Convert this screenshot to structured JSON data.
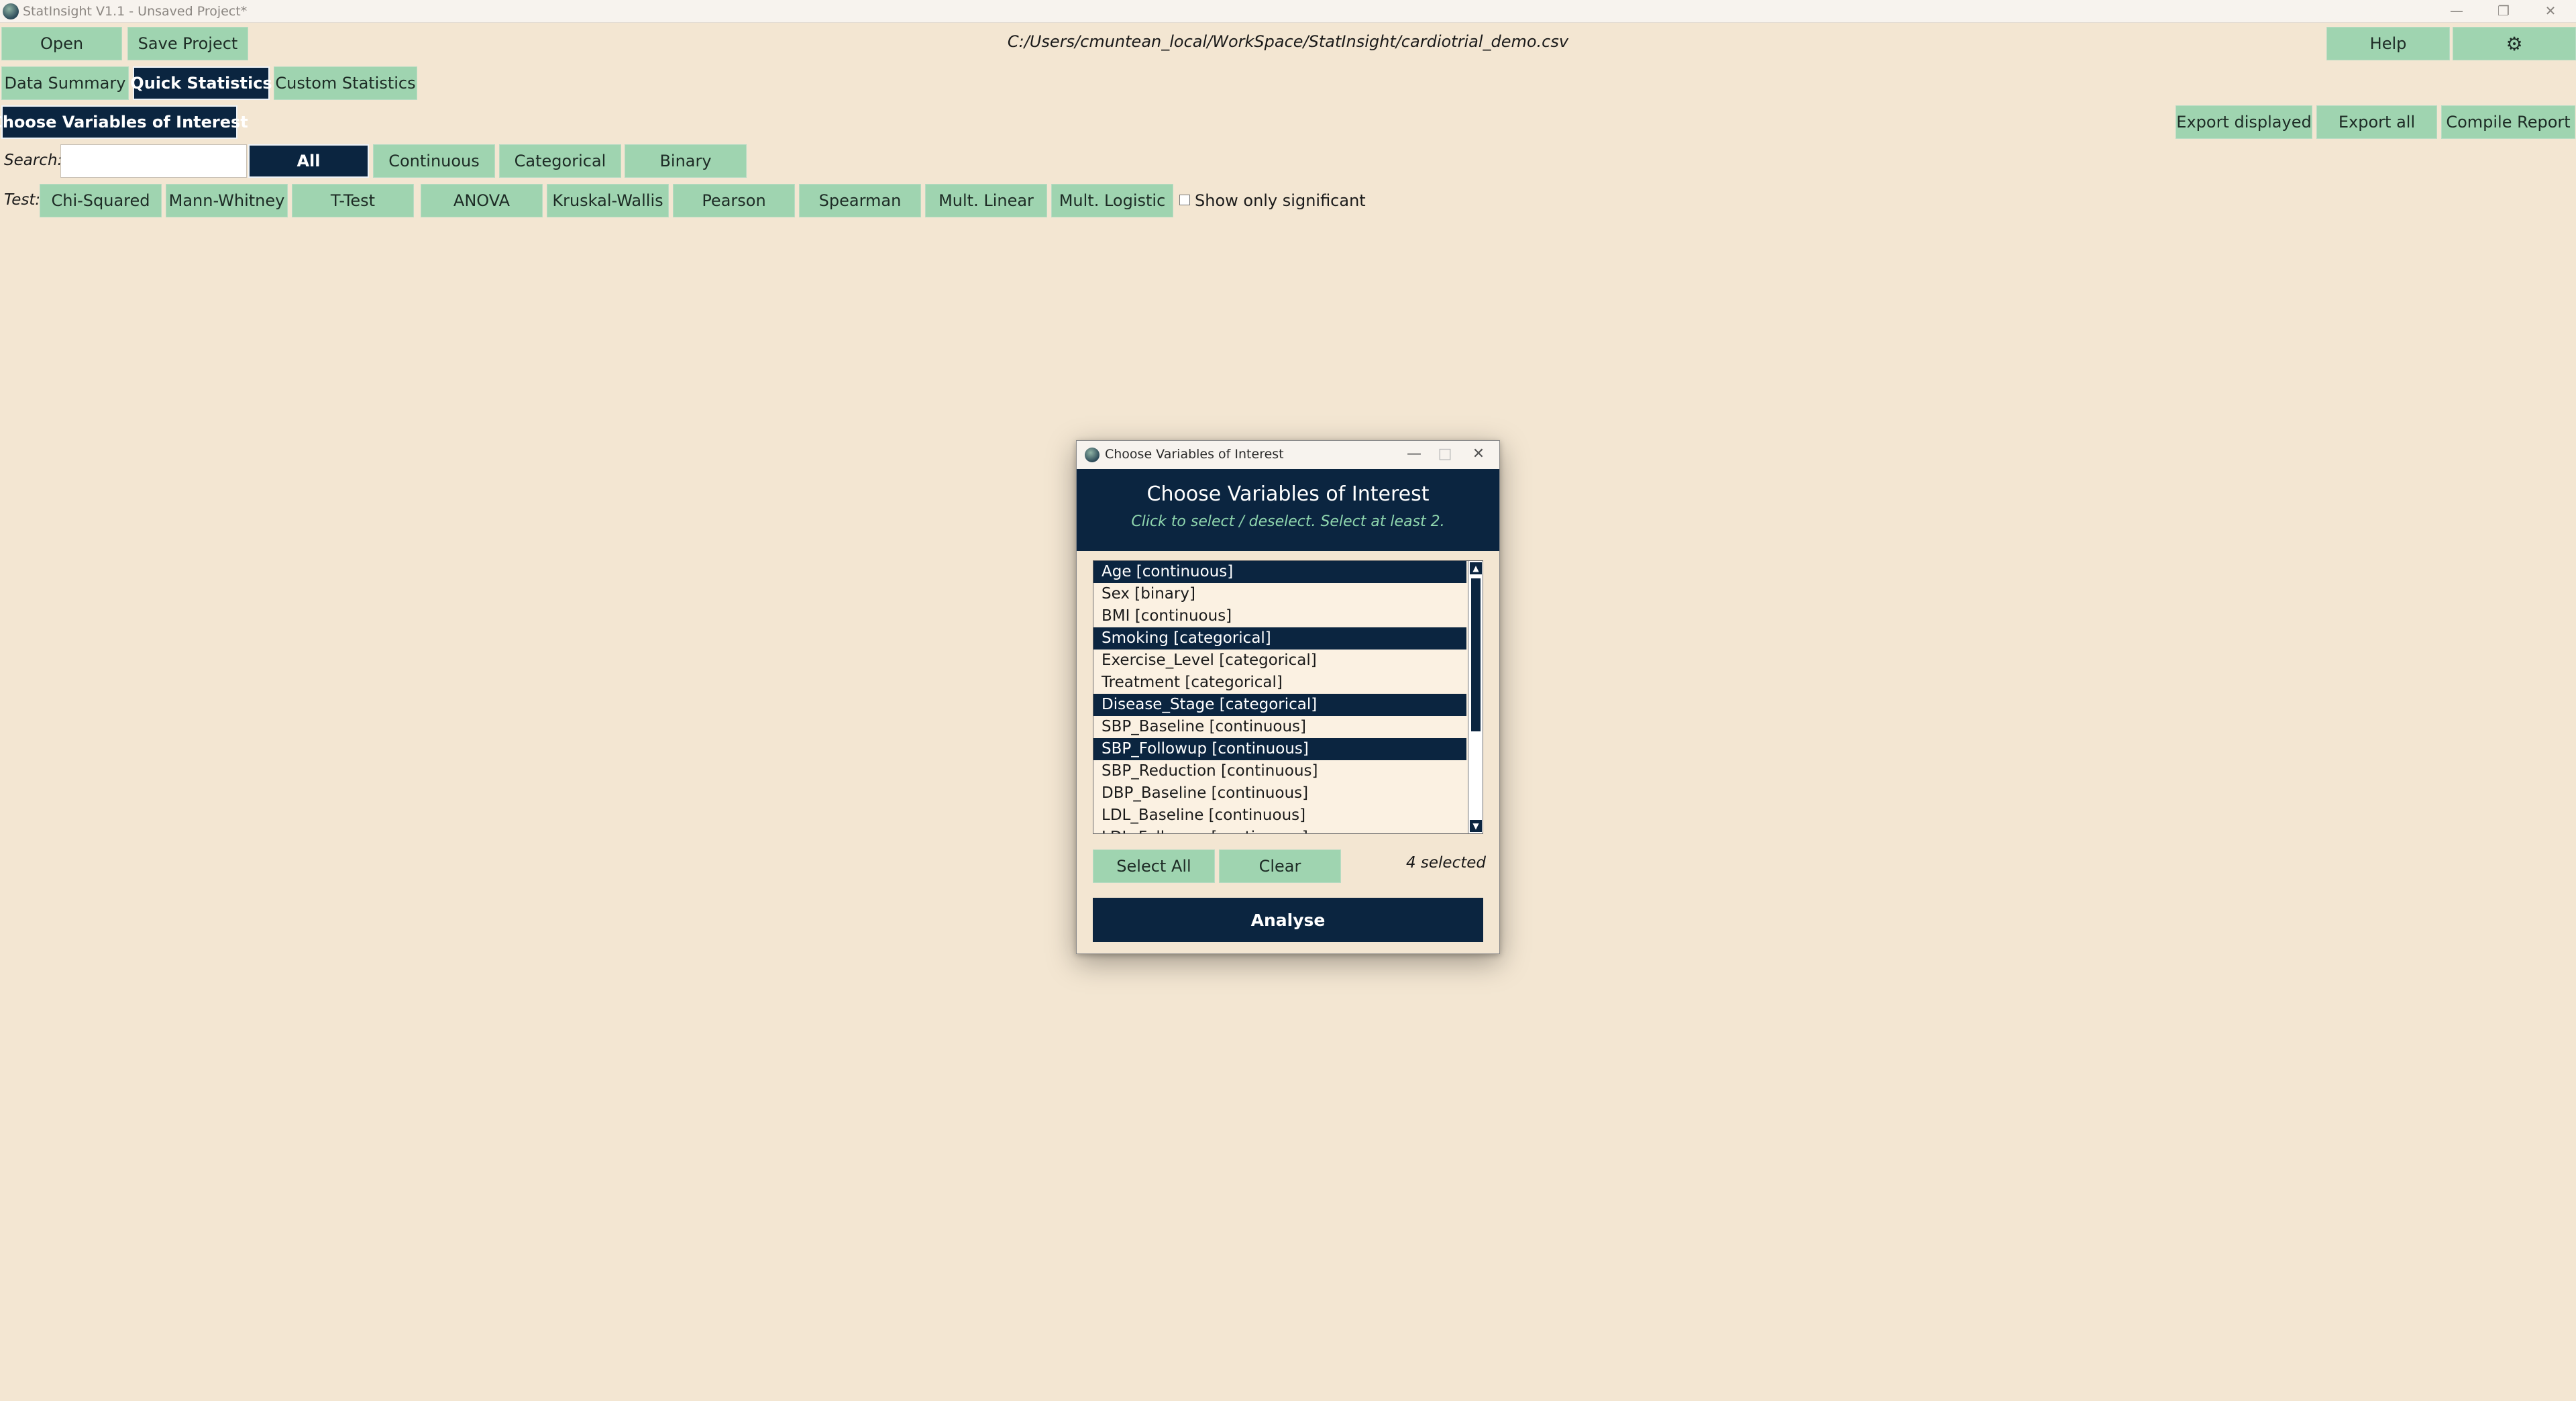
{
  "window": {
    "title": "StatInsight V1.1 - Unsaved Project*",
    "minimize": "—",
    "maximize": "❐",
    "close": "✕"
  },
  "toolbar": {
    "open": "Open",
    "save_project": "Save Project",
    "help": "Help",
    "settings_icon": "⚙"
  },
  "file_path": "C:/Users/cmuntean_local/WorkSpace/StatInsight/cardiotrial_demo.csv",
  "tabs": {
    "data_summary": "Data Summary",
    "quick_statistics": "Quick Statistics",
    "custom_statistics": "Custom Statistics"
  },
  "actions": {
    "choose_variables": "Choose Variables of Interest",
    "export_displayed": "Export displayed",
    "export_all": "Export all",
    "compile_report": "Compile Report"
  },
  "search": {
    "label": "Search:",
    "value": ""
  },
  "filters": [
    "All",
    "Continuous",
    "Categorical",
    "Binary"
  ],
  "test": {
    "label": "Test:",
    "buttons": [
      "Chi-Squared",
      "Mann-Whitney",
      "T-Test",
      "ANOVA",
      "Kruskal-Wallis",
      "Pearson",
      "Spearman",
      "Mult. Linear",
      "Mult. Logistic"
    ],
    "show_only_significant": "Show only significant"
  },
  "dialog": {
    "window_title": "Choose Variables of Interest",
    "minimize": "—",
    "maximize": "□",
    "close": "✕",
    "heading": "Choose Variables of Interest",
    "subtitle": "Click to select / deselect. Select at least 2.",
    "variables": [
      {
        "label": "Age  [continuous]",
        "selected": true
      },
      {
        "label": "Sex  [binary]",
        "selected": false
      },
      {
        "label": "BMI  [continuous]",
        "selected": false
      },
      {
        "label": "Smoking  [categorical]",
        "selected": true
      },
      {
        "label": "Exercise_Level  [categorical]",
        "selected": false
      },
      {
        "label": "Treatment  [categorical]",
        "selected": false
      },
      {
        "label": "Disease_Stage  [categorical]",
        "selected": true
      },
      {
        "label": "SBP_Baseline  [continuous]",
        "selected": false
      },
      {
        "label": "SBP_Followup  [continuous]",
        "selected": true
      },
      {
        "label": "SBP_Reduction  [continuous]",
        "selected": false
      },
      {
        "label": "DBP_Baseline  [continuous]",
        "selected": false
      },
      {
        "label": "LDL_Baseline  [continuous]",
        "selected": false
      },
      {
        "label": "LDL_Followup  [continuous]",
        "selected": false
      }
    ],
    "scroll_up": "▲",
    "scroll_down": "▼",
    "select_all": "Select All",
    "clear": "Clear",
    "selected_count": "4 selected",
    "analyse": "Analyse"
  },
  "colors": {
    "background": "#f3e6d2",
    "accent_green": "#9fd4b0",
    "navy": "#0b2540",
    "subtitle_green": "#8fd6ae"
  }
}
